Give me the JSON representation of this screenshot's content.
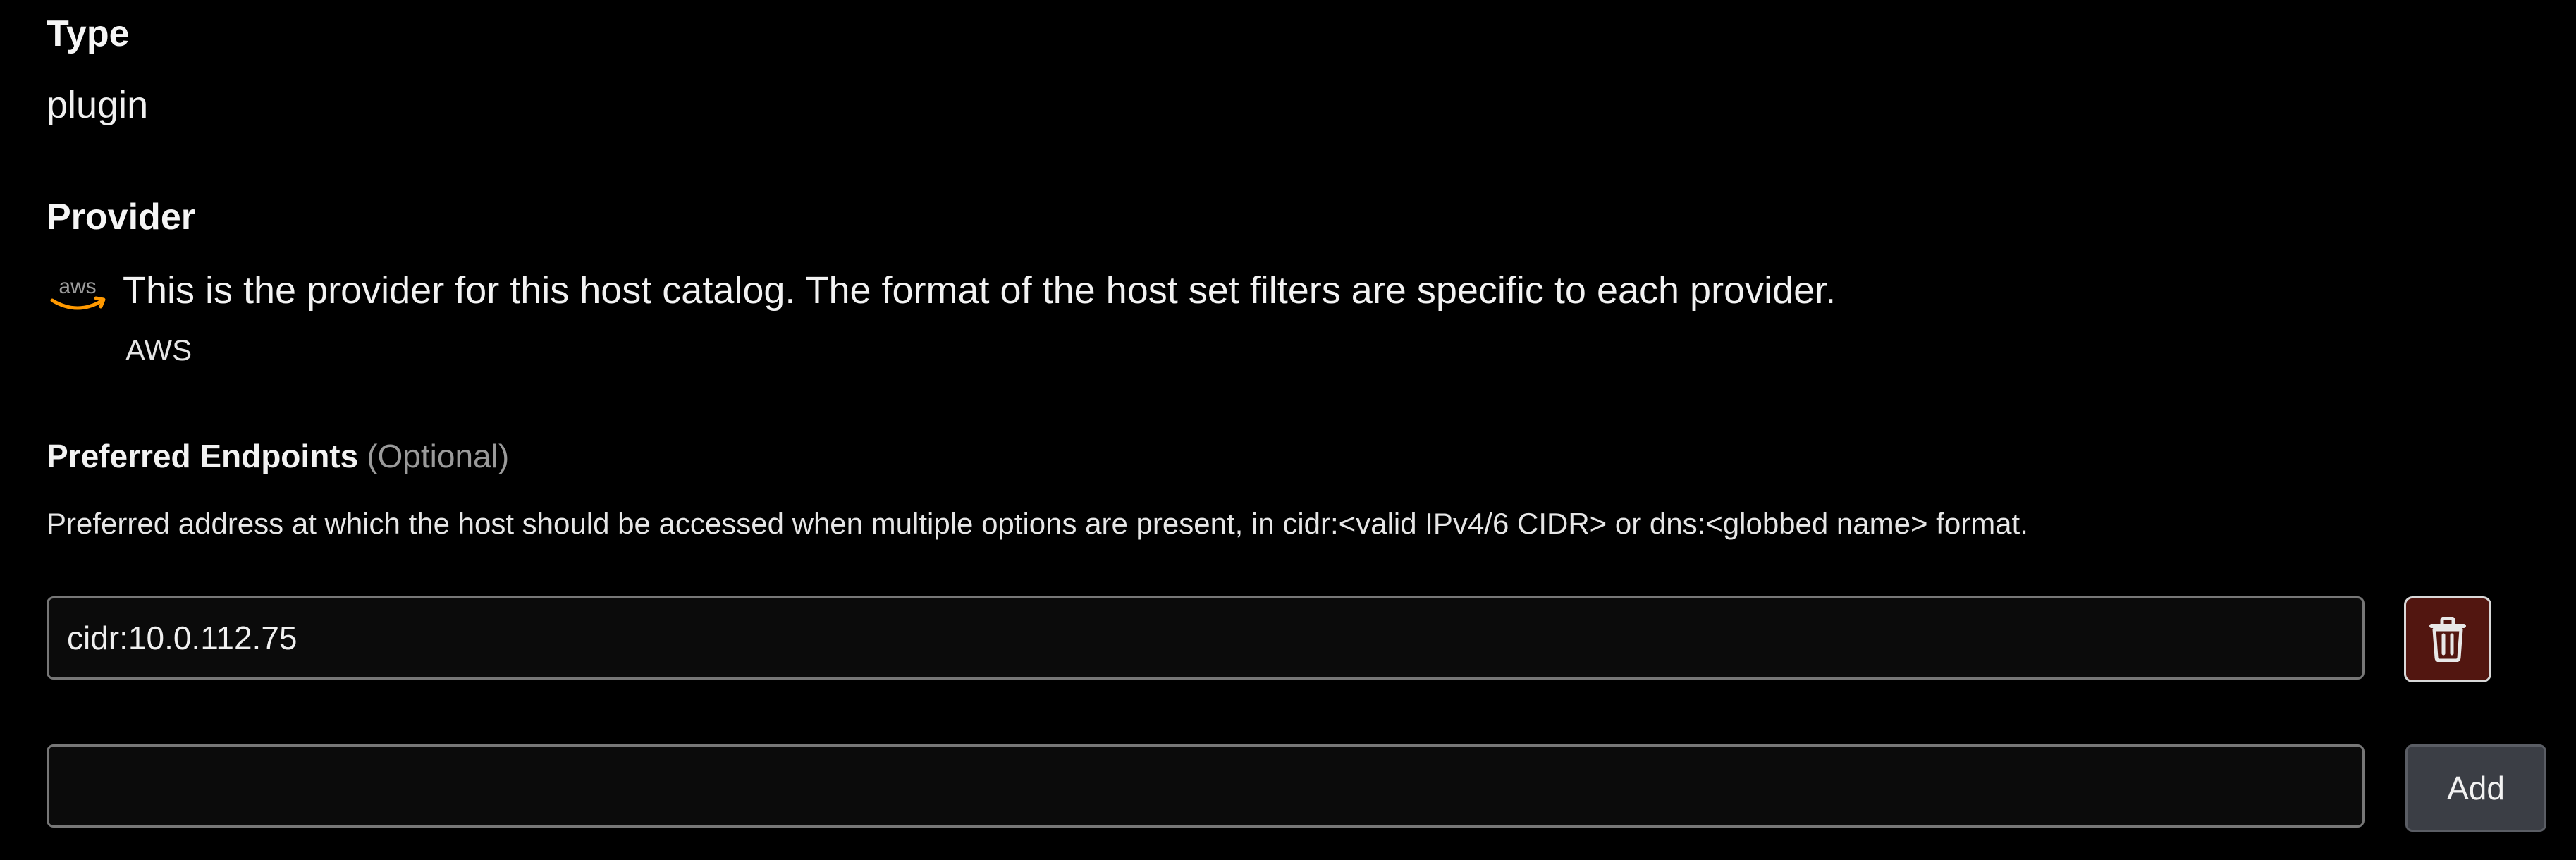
{
  "type_section": {
    "title": "Type",
    "value": "plugin"
  },
  "provider_section": {
    "title": "Provider",
    "icon": "aws-logo-icon",
    "logo_text": "aws",
    "description": "This is the provider for this host catalog. The format of the host set filters are specific to each provider.",
    "name": "AWS"
  },
  "preferred_endpoints": {
    "label": "Preferred Endpoints",
    "optional": "(Optional)",
    "help": "Preferred address at which the host should be accessed when multiple options are present, in cidr:<valid IPv4/6 CIDR> or dns:<globbed name> format.",
    "entries": [
      {
        "value": "cidr:10.0.112.75",
        "delete_icon": "trash-icon"
      }
    ],
    "new_entry": {
      "value": "",
      "add_label": "Add"
    }
  },
  "colors": {
    "background": "#000000",
    "delete_button_bg": "#521610",
    "add_button_bg": "#3b3e45",
    "aws_orange": "#ff9900",
    "optional_text": "#9a9a9a"
  }
}
